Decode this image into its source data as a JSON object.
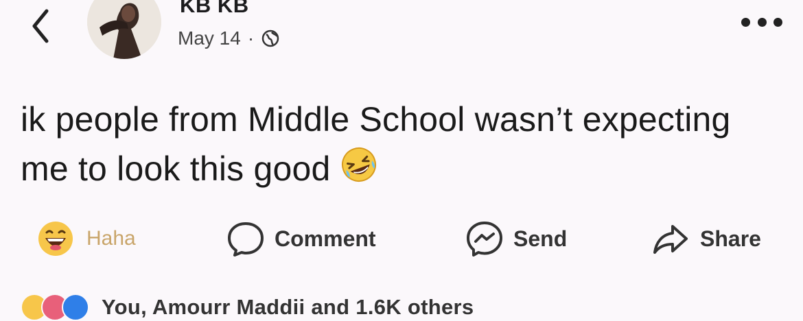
{
  "header": {
    "author_name": "KB KB",
    "date": "May 14",
    "separator": "·"
  },
  "post": {
    "text": "ik people from Middle School wasn’t expecting me to look this good"
  },
  "actions": {
    "haha_label": "Haha",
    "comment_label": "Comment",
    "send_label": "Send",
    "share_label": "Share"
  },
  "reactions": {
    "summary": "You, Amourr Maddii and 1.6K others"
  },
  "icons": {
    "back": "chevron-left-icon",
    "audience": "globe-icon",
    "more": "more-icon",
    "laugh_emoji": "rofl-emoji",
    "haha": "haha-reaction-icon",
    "comment": "comment-bubble-icon",
    "send": "messenger-icon",
    "share": "share-arrow-icon"
  },
  "colors": {
    "background": "#fbf8fb",
    "text": "#1c1c1e",
    "haha_label": "#c9a56a",
    "love": "#e8607a",
    "like": "#2f7fe8",
    "haha_face": "#f7c64a"
  }
}
